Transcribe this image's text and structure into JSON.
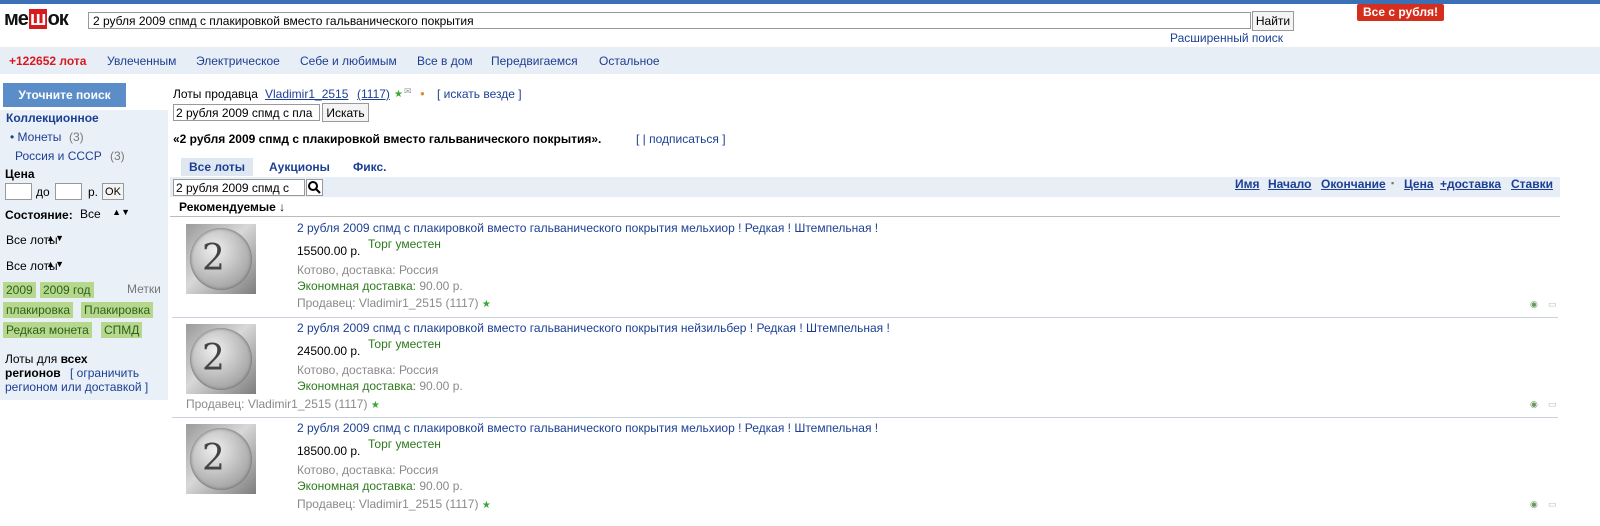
{
  "header": {
    "logo_left": "ме",
    "logo_mid": "ш",
    "logo_right": "ок",
    "search_value": "2 рубля 2009 спмд с плакировкой вместо гальванического покрытия",
    "find_label": "Найти",
    "advanced_search": "Расширенный поиск",
    "promo": "Все с рубля!"
  },
  "catbar": {
    "count": "+122652 лота",
    "items": [
      "Увлеченным",
      "Электрическое",
      "Себе и любимым",
      "Все в дом",
      "Передвигаемся",
      "Остальное"
    ]
  },
  "sidebar": {
    "refine": "Уточните поиск",
    "category": "Коллекционное",
    "sub1": "• Монеты",
    "sub1_count": "(3)",
    "sub2": "Россия и СССР",
    "sub2_count": "(3)",
    "price_label": "Цена",
    "price_to": "до",
    "price_unit": "р.",
    "ok": "OK",
    "condition_label": "Состояние:",
    "condition_value": "Все",
    "select1": "Все лоты",
    "select2": "Все лоты",
    "tags_label": "Метки",
    "tags": [
      "2009",
      "2009 год",
      "плакировка",
      "Плакировка",
      "Редкая монета",
      "СПМД"
    ],
    "region_line1_a": "Лоты для ",
    "region_line1_b": "всех",
    "region_line2": "регионов",
    "region_link1": "[ ограничить",
    "region_link2": "регионом или доставкой ]"
  },
  "seller_bar": {
    "label": "Лоты продавца",
    "seller": "Vladimir1_2515",
    "rating": "(1117)",
    "search_everywhere": "[ искать везде ]",
    "inner_search_value": "2 рубля 2009 спмд с пла",
    "inner_search_btn": "Искать"
  },
  "query_line": {
    "text": "«2 рубля 2009 спмд с плакировкой вместо гальванического покрытия».",
    "subscribe": "[ | подписаться ]"
  },
  "tabs": [
    "Все лоты",
    "Аукционы",
    "Фикс."
  ],
  "filter": {
    "value": "2 рубля 2009 спмд с",
    "sort_links": [
      "Имя",
      "Начало",
      "Окончание",
      "Цена",
      "+доставка",
      "Ставки"
    ]
  },
  "recommended": "Рекомендуемые ↓",
  "lots": [
    {
      "title": "2 рубля 2009 спмд с плакировкой вместо гальванического покрытия мельхиор ! Редкая ! Штемпельная !",
      "price": "15500.00 р.",
      "haggle": "Торг уместен",
      "location": "Котово, доставка: Россия",
      "shipping_label": "Экономная доставка:",
      "shipping_value": "90.00 р.",
      "seller": "Продавец: Vladimir1_2515 (1117)"
    },
    {
      "title": "2 рубля 2009 спмд с плакировкой вместо гальванического покрытия нейзильбер ! Редкая ! Штемпельная !",
      "price": "24500.00 р.",
      "haggle": "Торг уместен",
      "location": "Котово, доставка: Россия",
      "shipping_label": "Экономная доставка:",
      "shipping_value": "90.00 р.",
      "seller": "Продавец: Vladimir1_2515 (1117)"
    },
    {
      "title": "2 рубля 2009 спмд с плакировкой вместо гальванического покрытия мельхиор ! Редкая ! Штемпельная !",
      "price": "18500.00 р.",
      "haggle": "Торг уместен",
      "location": "Котово, доставка: Россия",
      "shipping_label": "Экономная доставка:",
      "shipping_value": "90.00 р.",
      "seller": "Продавец: Vladimir1_2515 (1117)"
    }
  ],
  "coin_digit": "2",
  "colors": {
    "accent": "#1c3f95",
    "brand_red": "#d71920",
    "tag_green": "#b5d88d",
    "panel": "#eaf0f7"
  }
}
